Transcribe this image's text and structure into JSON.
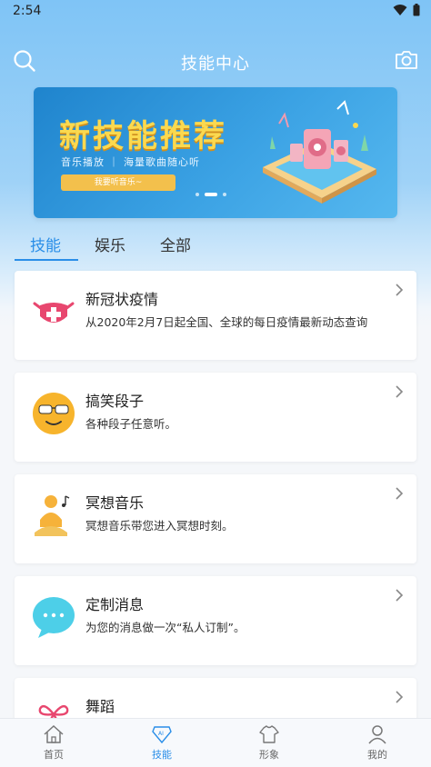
{
  "status": {
    "time": "2:54"
  },
  "header": {
    "title": "技能中心"
  },
  "banner": {
    "title": "新技能推荐",
    "subtitle": "音乐播放 ｜ 海量歌曲随心听",
    "button": "我要听音乐~"
  },
  "tabs": [
    {
      "label": "技能",
      "active": true
    },
    {
      "label": "娱乐",
      "active": false
    },
    {
      "label": "全部",
      "active": false
    }
  ],
  "cards": [
    {
      "title": "新冠状疫情",
      "desc": "从2020年2月7日起全国、全球的每日疫情最新动态查询",
      "icon": "mask-icon"
    },
    {
      "title": "搞笑段子",
      "desc": "各种段子任意听。",
      "icon": "smiley-glasses-icon"
    },
    {
      "title": "冥想音乐",
      "desc": "冥想音乐带您进入冥想时刻。",
      "icon": "meditation-icon"
    },
    {
      "title": "定制消息",
      "desc": "为您的消息做一次“私人订制”。",
      "icon": "chat-bubble-icon"
    },
    {
      "title": "舞蹈",
      "desc": "",
      "icon": "ribbon-icon"
    }
  ],
  "bottom_nav": [
    {
      "label": "首页",
      "icon": "home-icon",
      "active": false
    },
    {
      "label": "技能",
      "icon": "ai-skill-icon",
      "active": true
    },
    {
      "label": "形象",
      "icon": "avatar-shirt-icon",
      "active": false
    },
    {
      "label": "我的",
      "icon": "profile-icon",
      "active": false
    }
  ],
  "colors": {
    "accent": "#2a8ee8",
    "banner_title": "#fbd94f"
  }
}
